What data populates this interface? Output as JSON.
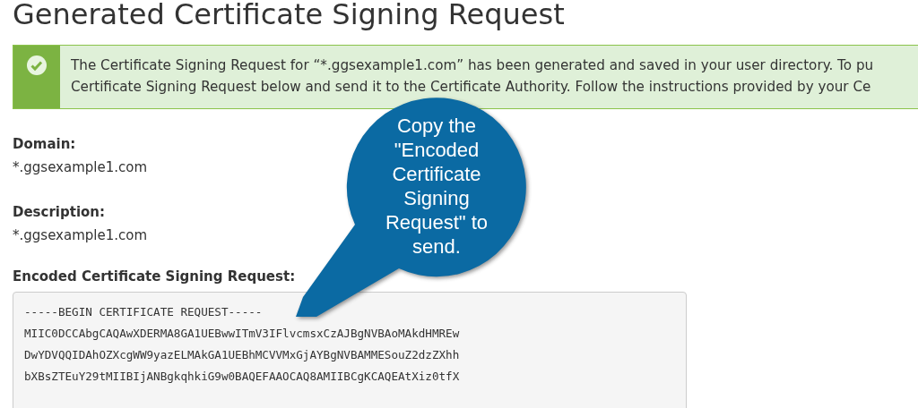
{
  "heading": "Generated Certificate Signing Request",
  "alert": {
    "kind": "success",
    "lines": [
      "The Certificate Signing Request for “*.ggsexample1.com” has been generated and saved in your user directory. To pu",
      "Certificate Signing Request below and send it to the Certificate Authority. Follow the instructions provided by your Ce"
    ]
  },
  "fields": [
    {
      "label": "Domain:",
      "value": "*.ggsexample1.com"
    },
    {
      "label": "Description:",
      "value": "*.ggsexample1.com"
    }
  ],
  "csr": {
    "label": "Encoded Certificate Signing Request:",
    "lines": [
      "-----BEGIN CERTIFICATE REQUEST-----",
      "MIIC0DCCAbgCAQAwXDERMA8GA1UEBwwITmV3IFlvcmsxCzAJBgNVBAoMAkdHMREw",
      "DwYDVQQIDAhOZXcgWW9yazELMAkGA1UEBhMCVVMxGjAYBgNVBAMMESouZ2dzZXhh",
      "bXBsZTEuY29tMIIBIjANBgkqhkiG9w0BAQEFAAOCAQ8AMIIBCgKCAQEAtXiz0tfX"
    ]
  },
  "callout": {
    "lines": [
      "Copy the",
      "\"Encoded",
      "Certificate",
      "Signing",
      "Request\" to",
      "send."
    ]
  }
}
